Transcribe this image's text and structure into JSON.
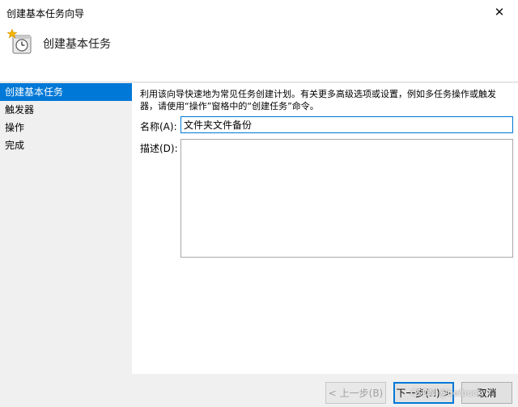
{
  "window": {
    "title": "创建基本任务向导",
    "close_glyph": "✕"
  },
  "header": {
    "title": "创建基本任务",
    "icon": "clock-task-icon"
  },
  "sidebar": {
    "items": [
      {
        "label": "创建基本任务",
        "active": true
      },
      {
        "label": "触发器"
      },
      {
        "label": "操作"
      },
      {
        "label": "完成"
      }
    ]
  },
  "content": {
    "description": "利用该向导快速地为常见任务创建计划。有关更多高级选项或设置，例如多任务操作或触发器，请使用“操作”窗格中的“创建任务”命令。",
    "name_label": "名称(A):",
    "name_value": "文件夹文件备份",
    "desc_label": "描述(D):",
    "desc_value": ""
  },
  "footer": {
    "back_label": "< 上一步(B)",
    "next_label": "下一步(N) >",
    "cancel_label": "取消"
  },
  "watermark": "CSDN @belbuck",
  "colors": {
    "accent": "#0078d7",
    "panel": "#ffffff",
    "chrome": "#f0f0f0"
  }
}
